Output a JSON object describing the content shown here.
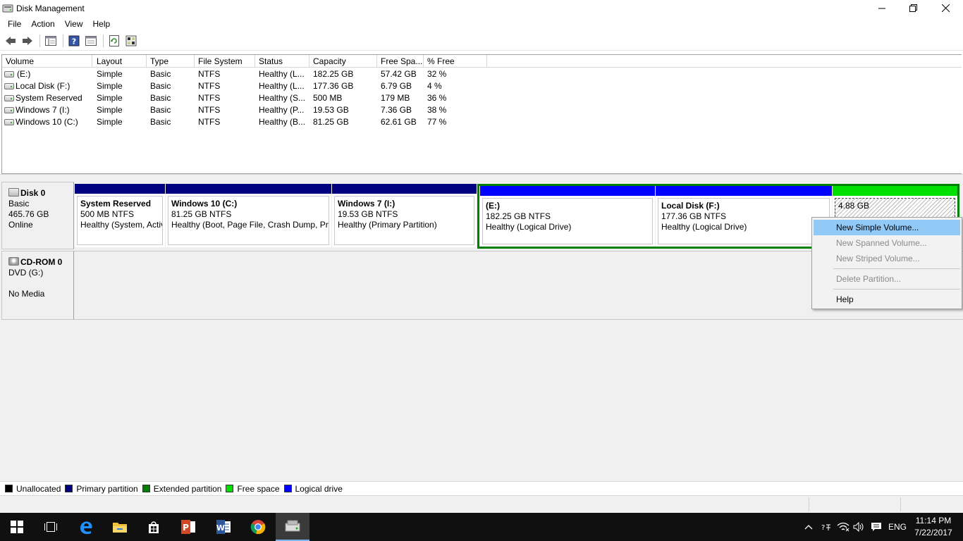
{
  "window": {
    "title": "Disk Management"
  },
  "menu": [
    "File",
    "Action",
    "View",
    "Help"
  ],
  "volume_table": {
    "columns": [
      "Volume",
      "Layout",
      "Type",
      "File System",
      "Status",
      "Capacity",
      "Free Spa...",
      "% Free"
    ],
    "rows": [
      [
        "(E:)",
        "Simple",
        "Basic",
        "NTFS",
        "Healthy (L...",
        "182.25 GB",
        "57.42 GB",
        "32 %"
      ],
      [
        "Local Disk (F:)",
        "Simple",
        "Basic",
        "NTFS",
        "Healthy (L...",
        "177.36 GB",
        "6.79 GB",
        "4 %"
      ],
      [
        "System Reserved",
        "Simple",
        "Basic",
        "NTFS",
        "Healthy (S...",
        "500 MB",
        "179 MB",
        "36 %"
      ],
      [
        "Windows 7 (I:)",
        "Simple",
        "Basic",
        "NTFS",
        "Healthy (P...",
        "19.53 GB",
        "7.36 GB",
        "38 %"
      ],
      [
        "Windows 10 (C:)",
        "Simple",
        "Basic",
        "NTFS",
        "Healthy (B...",
        "81.25 GB",
        "62.61 GB",
        "77 %"
      ]
    ]
  },
  "disk0": {
    "name": "Disk 0",
    "type": "Basic",
    "size": "465.76 GB",
    "state": "Online",
    "partitions": [
      {
        "name": "System Reserved",
        "size": "500 MB NTFS",
        "status": "Healthy (System, Active, Primary Partition)"
      },
      {
        "name": "Windows 10  (C:)",
        "size": "81.25 GB NTFS",
        "status": "Healthy (Boot, Page File, Crash Dump, Primary Partition)"
      },
      {
        "name": "Windows 7  (I:)",
        "size": "19.53 GB NTFS",
        "status": "Healthy (Primary Partition)"
      },
      {
        "name": "(E:)",
        "size": "182.25 GB NTFS",
        "status": "Healthy (Logical Drive)"
      },
      {
        "name": "Local Disk  (F:)",
        "size": "177.36 GB NTFS",
        "status": "Healthy (Logical Drive)"
      },
      {
        "name": "",
        "size": "4.88 GB",
        "status": ""
      }
    ]
  },
  "cdrom0": {
    "name": "CD-ROM 0",
    "drive": "DVD (G:)",
    "media": "No Media"
  },
  "legend": [
    {
      "label": "Unallocated",
      "color": "#000000"
    },
    {
      "label": "Primary partition",
      "color": "#000080"
    },
    {
      "label": "Extended partition",
      "color": "#008000"
    },
    {
      "label": "Free space",
      "color": "#00e000"
    },
    {
      "label": "Logical drive",
      "color": "#0000ff"
    }
  ],
  "context_menu": {
    "new_simple": "New Simple Volume...",
    "new_spanned": "New Spanned Volume...",
    "new_striped": "New Striped Volume...",
    "delete": "Delete Partition...",
    "help": "Help"
  },
  "taskbar": {
    "language": "ENG",
    "time": "11:14 PM",
    "date": "7/22/2017"
  },
  "colors": {
    "primary_bar": "#000080",
    "logical_bar": "#0000ff",
    "free_bar": "#00e000",
    "extended_border": "#008000",
    "menu_highlight": "#91c9f7"
  }
}
